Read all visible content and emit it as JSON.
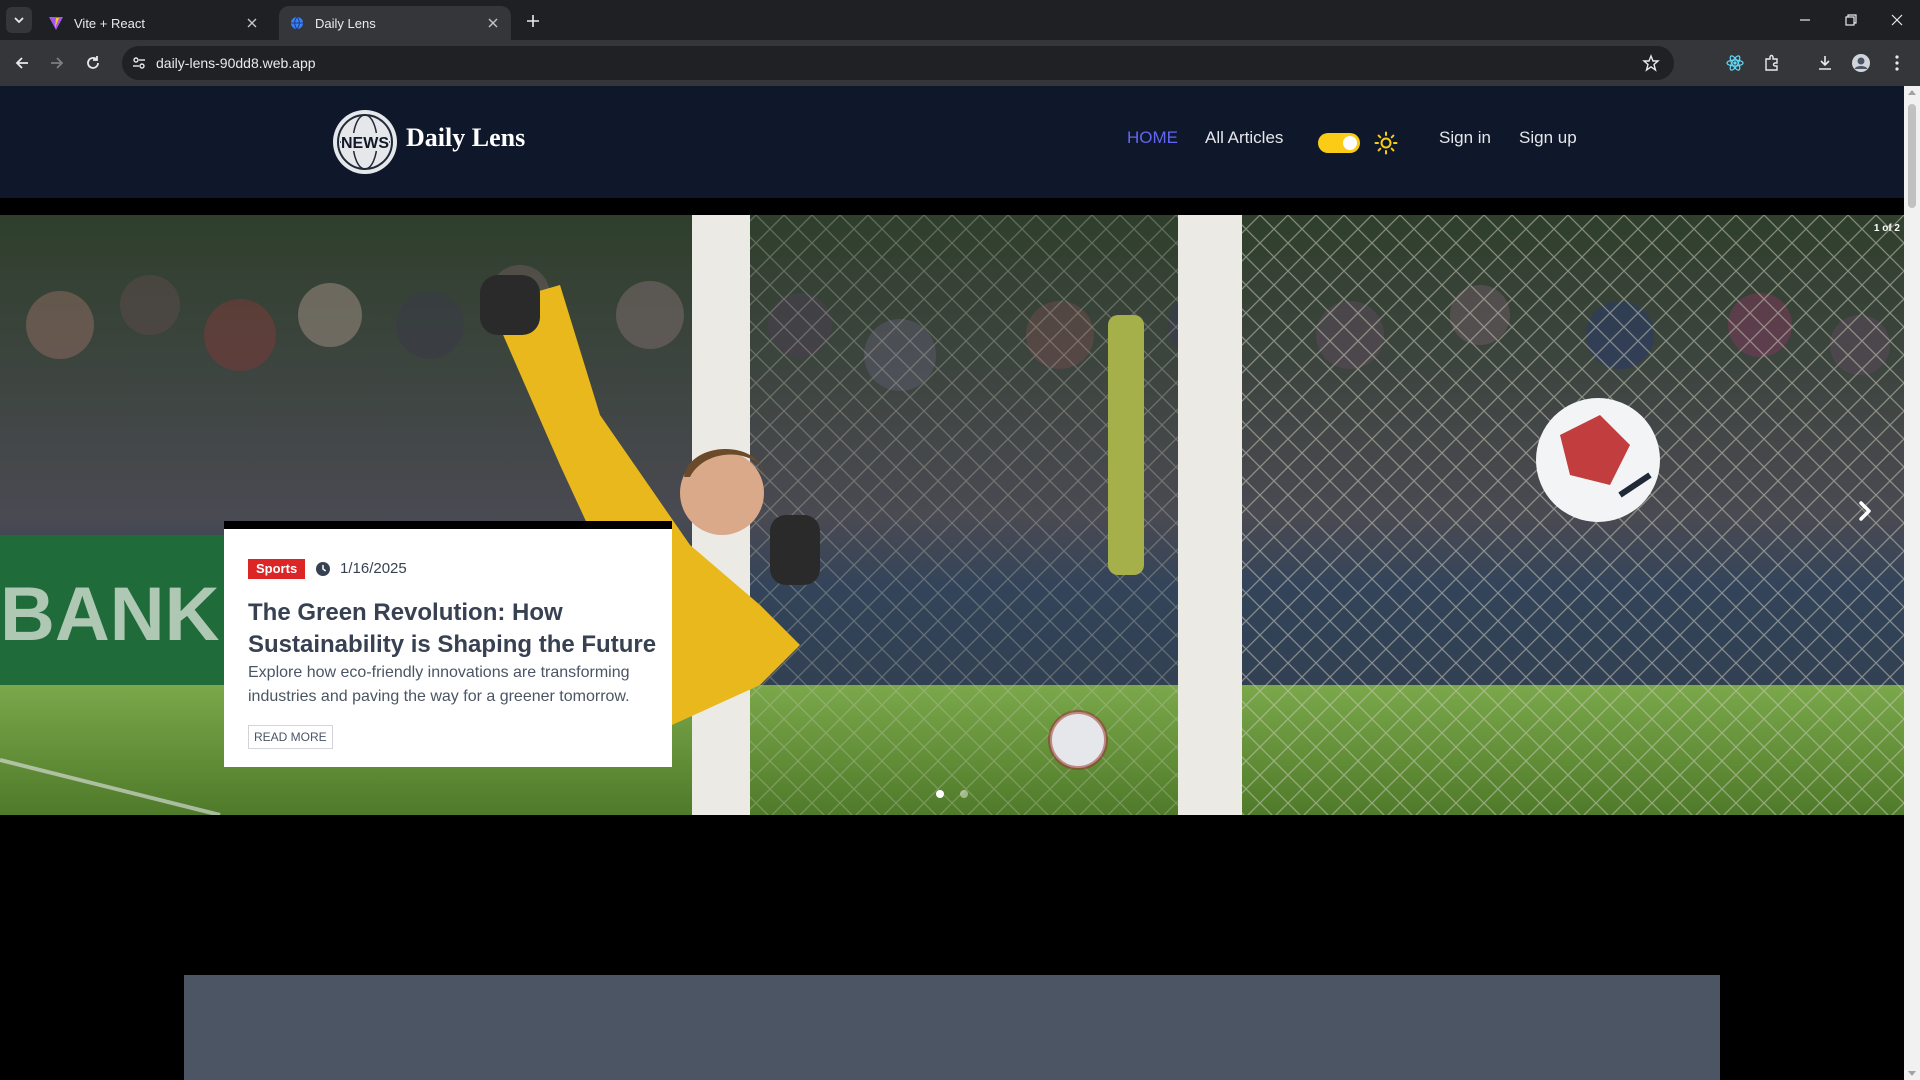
{
  "browser": {
    "tabs": [
      {
        "title": "Vite + React",
        "active": false
      },
      {
        "title": "Daily Lens",
        "active": true
      }
    ],
    "url": "daily-lens-90dd8.web.app"
  },
  "site": {
    "logo_text": "NEWS",
    "brand": "Daily Lens",
    "nav": {
      "home": "HOME",
      "all_articles": "All Articles",
      "sign_in": "Sign in",
      "sign_up": "Sign up"
    },
    "theme_toggle_on": true
  },
  "carousel": {
    "counter": "1 of 2",
    "slide_count": 2,
    "active_slide": 1,
    "article": {
      "category": "Sports",
      "date": "1/16/2025",
      "title": "The Green Revolution: How Sustainability is Shaping the Future",
      "excerpt": "Explore how eco-friendly innovations are transforming industries and paving the way for a greener tomorrow.",
      "cta": "READ MORE"
    }
  },
  "colors": {
    "header_bg": "#0f172a",
    "nav_active": "#6366f1",
    "toggle": "#facc15",
    "badge": "#dc2626"
  }
}
